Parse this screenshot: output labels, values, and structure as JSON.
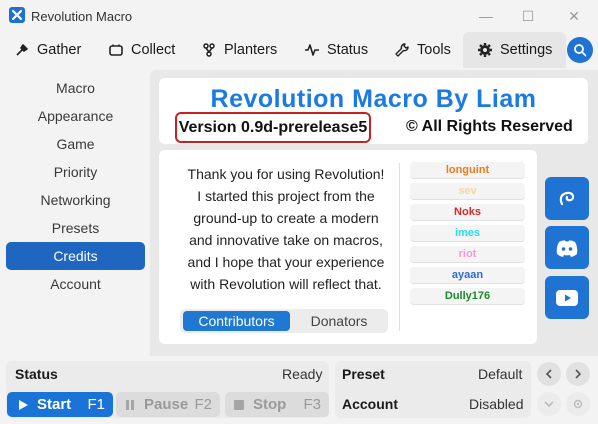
{
  "window": {
    "title": "Revolution Macro",
    "minimize_glyph": "—",
    "maximize_glyph": "☐",
    "close_glyph": "✕"
  },
  "nav": {
    "tabs": [
      {
        "label": "Gather",
        "icon": "gather-icon"
      },
      {
        "label": "Collect",
        "icon": "collect-icon"
      },
      {
        "label": "Planters",
        "icon": "planters-icon"
      },
      {
        "label": "Status",
        "icon": "status-icon"
      },
      {
        "label": "Tools",
        "icon": "tools-icon"
      },
      {
        "label": "Settings",
        "icon": "gear-icon",
        "active": true
      }
    ]
  },
  "sidebar": {
    "items": [
      {
        "label": "Macro"
      },
      {
        "label": "Appearance"
      },
      {
        "label": "Game"
      },
      {
        "label": "Priority"
      },
      {
        "label": "Networking"
      },
      {
        "label": "Presets"
      },
      {
        "label": "Credits",
        "active": true
      },
      {
        "label": "Account"
      }
    ]
  },
  "header": {
    "title": "Revolution Macro By Liam",
    "version": "Version 0.9d-prerelease5",
    "rights": "© All Rights Reserved"
  },
  "credits": {
    "message_lines": [
      "Thank you for using Revolution!",
      "I started this project from the",
      "ground-up to create a modern",
      "and innovative take on macros,",
      "and I hope that your experience",
      "with Revolution will reflect that."
    ],
    "names": [
      {
        "label": "longuint",
        "color": "#f07a1a"
      },
      {
        "label": "sev",
        "color": "#f3d7a0"
      },
      {
        "label": "Noks",
        "color": "#d42a2a"
      },
      {
        "label": "imes",
        "color": "#22e0e8"
      },
      {
        "label": "riot",
        "color": "#f09ad6"
      },
      {
        "label": "ayaan",
        "color": "#2a6fd6"
      },
      {
        "label": "Dully176",
        "color": "#1a8a2a"
      }
    ],
    "segments": [
      {
        "label": "Contributors",
        "active": true
      },
      {
        "label": "Donators"
      }
    ]
  },
  "status": {
    "label": "Status",
    "value": "Ready",
    "start": {
      "label": "Start",
      "key": "F1"
    },
    "pause": {
      "label": "Pause",
      "key": "F2"
    },
    "stop": {
      "label": "Stop",
      "key": "F3"
    }
  },
  "preset": {
    "label": "Preset",
    "value": "Default",
    "account_label": "Account",
    "account_value": "Disabled"
  },
  "colors": {
    "accent": "#1e73d3",
    "title_blue": "#1b7ae3",
    "version_border": "#c8201f"
  }
}
